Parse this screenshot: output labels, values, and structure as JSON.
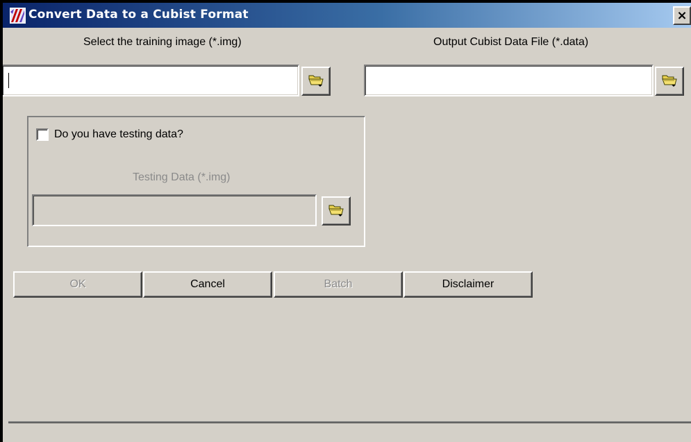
{
  "window": {
    "title": "Convert Data to a Cubist Format",
    "close_label": "×"
  },
  "training": {
    "label": "Select the training image (*.img)",
    "value": ""
  },
  "output": {
    "label": "Output Cubist Data File (*.data)",
    "value": ""
  },
  "testing": {
    "checkbox_label": "Do you have testing data?",
    "checked": false,
    "field_label": "Testing Data (*.img)",
    "value": ""
  },
  "buttons": {
    "ok": "OK",
    "cancel": "Cancel",
    "batch": "Batch",
    "disclaimer": "Disclaimer"
  },
  "icons": {
    "app": "cubist-app-icon",
    "browse": "folder-open-icon",
    "close": "close-icon"
  },
  "colors": {
    "title_start": "#0a246a",
    "title_end": "#a6caf0",
    "face": "#d4d0c8",
    "folder": "#e8d050"
  }
}
